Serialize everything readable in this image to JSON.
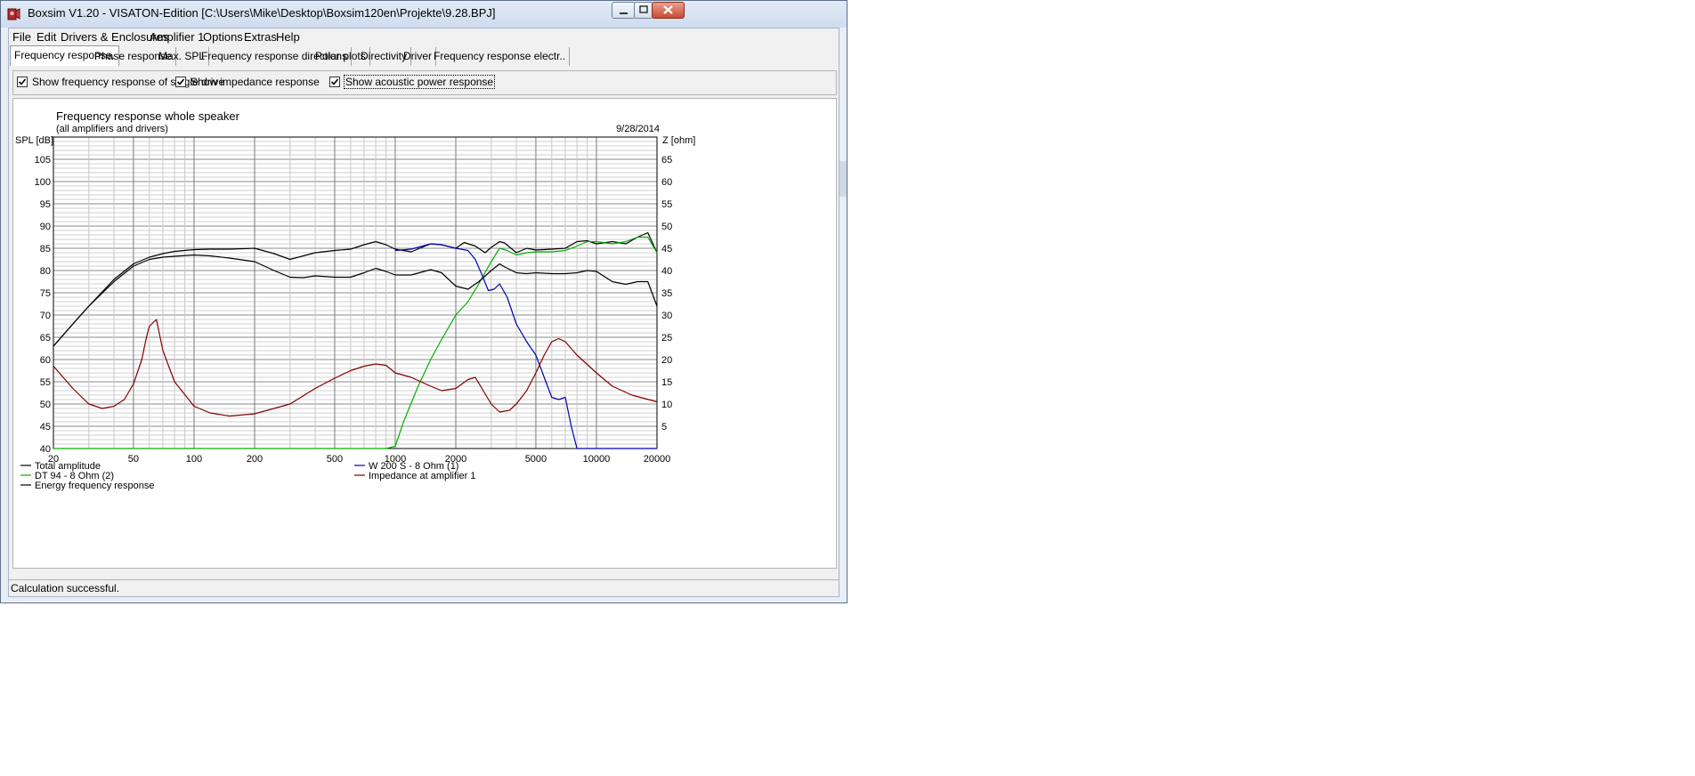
{
  "window": {
    "title": "Boxsim V1.20 - VISATON-Edition [C:\\Users\\Mike\\Desktop\\Boxsim120en\\Projekte\\9.28.BPJ]"
  },
  "menu": [
    "File",
    "Edit",
    "Drivers & Enclosures",
    "Amplifier 1",
    "Options",
    "Extras",
    "Help"
  ],
  "tabs": [
    "Frequency response.",
    "Phase response",
    "Max. SPL",
    "Frequency response directions",
    "Polar plots",
    "Directivity",
    "Driver",
    "Frequency response electr.."
  ],
  "active_tab": "Frequency response.",
  "options": {
    "single_drive": {
      "label": "Show frequency response of single drive",
      "checked": true
    },
    "impedance": {
      "label": "Show impedance response",
      "checked": true
    },
    "acoustic_power": {
      "label": "Show acoustic power response",
      "checked": true
    }
  },
  "status": "Calculation successful.",
  "colors": {
    "total": "#000000",
    "dt94": "#00b000",
    "energy": "#000000",
    "w200": "#0000b0",
    "impedance": "#800000"
  },
  "chart_data": {
    "type": "line",
    "title": "Frequency response whole speaker",
    "subtitle": "(all amplifiers and drivers)",
    "date": "9/28/2014",
    "ylabel": "SPL [dB]",
    "y2label": "Z [ohm]",
    "x_scale": "log",
    "xlim": [
      20,
      20000
    ],
    "ylim": [
      40,
      110
    ],
    "y2lim": [
      0,
      70
    ],
    "x_ticks": [
      20,
      50,
      100,
      200,
      500,
      1000,
      2000,
      5000,
      10000,
      20000
    ],
    "y_ticks": [
      40,
      45,
      50,
      55,
      60,
      65,
      70,
      75,
      80,
      85,
      90,
      95,
      100,
      105
    ],
    "y2_ticks": [
      5,
      10,
      15,
      20,
      25,
      30,
      35,
      40,
      45,
      50,
      55,
      60,
      65
    ],
    "grid": true,
    "legend_position": "bottom",
    "series": [
      {
        "name": "Total amplitude",
        "color_key": "total",
        "axis": "left",
        "x": [
          20,
          25,
          30,
          40,
          50,
          60,
          70,
          80,
          100,
          120,
          150,
          200,
          250,
          300,
          400,
          500,
          600,
          700,
          800,
          900,
          1000,
          1200,
          1500,
          1700,
          2000,
          2200,
          2500,
          2800,
          3000,
          3300,
          3500,
          4000,
          4500,
          5000,
          6000,
          7000,
          8000,
          9000,
          10000,
          12000,
          14000,
          16000,
          18000,
          20000
        ],
        "y": [
          63,
          68,
          72,
          78,
          81.5,
          83,
          83.8,
          84.3,
          84.7,
          84.8,
          84.8,
          85,
          83.8,
          82.5,
          84,
          84.5,
          84.8,
          85.8,
          86.5,
          85.8,
          84.8,
          84.2,
          86,
          85.8,
          85,
          86.3,
          85.5,
          84,
          85.2,
          86.5,
          86.2,
          84,
          85,
          84.6,
          84.8,
          85,
          86.5,
          86.7,
          86,
          86.5,
          86,
          87.5,
          88.5,
          84
        ]
      },
      {
        "name": "DT 94 - 8 Ohm (2)",
        "color_key": "dt94",
        "axis": "left",
        "x": [
          20,
          500,
          900,
          1000,
          1100,
          1300,
          1500,
          1700,
          2000,
          2300,
          2600,
          3000,
          3300,
          3600,
          4000,
          4500,
          5000,
          6000,
          7000,
          8000,
          9000,
          10000,
          12000,
          14000,
          16000,
          18000,
          20000
        ],
        "y": [
          40,
          40,
          40,
          40.5,
          46,
          54,
          60,
          64.5,
          70,
          73,
          77,
          82,
          85,
          84.5,
          83.5,
          84,
          84.2,
          84.2,
          84.5,
          85.5,
          86.5,
          86.5,
          86,
          86.5,
          87.5,
          87.5,
          84
        ]
      },
      {
        "name": "Energy frequency response",
        "color_key": "energy",
        "axis": "left",
        "x": [
          20,
          25,
          30,
          40,
          50,
          60,
          70,
          80,
          100,
          120,
          150,
          200,
          250,
          300,
          350,
          400,
          500,
          600,
          700,
          800,
          900,
          1000,
          1200,
          1500,
          1700,
          2000,
          2300,
          2600,
          3000,
          3300,
          3500,
          4000,
          4500,
          5000,
          6000,
          7000,
          8000,
          9000,
          10000,
          12000,
          14000,
          16000,
          18000,
          20000
        ],
        "y": [
          63,
          68,
          72,
          77.5,
          81,
          82.5,
          83,
          83.2,
          83.5,
          83.3,
          82.8,
          82,
          80,
          78.5,
          78.4,
          78.8,
          78.5,
          78.5,
          79.5,
          80.5,
          79.8,
          79,
          79,
          80.2,
          79.5,
          76.5,
          75.8,
          77.5,
          80,
          81.5,
          80.8,
          79.5,
          79.3,
          79.5,
          79.3,
          79.3,
          79.5,
          80,
          79.8,
          77.5,
          76.9,
          77.5,
          77.5,
          72
        ]
      },
      {
        "name": "W 200 S - 8 Ohm (1)",
        "color_key": "w200",
        "axis": "left",
        "x": [
          1000,
          1200,
          1500,
          1700,
          2000,
          2300,
          2500,
          2700,
          2900,
          3100,
          3300,
          3600,
          4000,
          4500,
          5000,
          5500,
          6000,
          6500,
          7000,
          7500,
          8000,
          8500,
          20000
        ],
        "y": [
          84.5,
          84.8,
          86,
          85.8,
          85,
          84.5,
          82.5,
          79,
          75.5,
          75.8,
          77,
          74,
          68,
          64,
          61,
          56,
          51.5,
          51,
          51.5,
          45,
          40,
          40,
          40
        ]
      },
      {
        "name": "Impedance at amplifier 1",
        "color_key": "impedance",
        "axis": "right",
        "x": [
          20,
          25,
          30,
          35,
          40,
          45,
          50,
          55,
          58,
          60,
          65,
          70,
          80,
          100,
          120,
          150,
          200,
          300,
          400,
          500,
          600,
          700,
          800,
          900,
          1000,
          1200,
          1500,
          1700,
          2000,
          2300,
          2500,
          3000,
          3300,
          3700,
          4000,
          4500,
          5000,
          5500,
          6000,
          6500,
          7000,
          8000,
          10000,
          12000,
          15000,
          20000
        ],
        "y": [
          18.5,
          13.5,
          10,
          9,
          9.5,
          11,
          14.5,
          20,
          25,
          27.5,
          29,
          22,
          15,
          9.5,
          8,
          7.3,
          7.8,
          10,
          13.5,
          15.8,
          17.5,
          18.5,
          19,
          18.7,
          17,
          16,
          14,
          13,
          13.5,
          15.5,
          16,
          10,
          8.2,
          8.6,
          10,
          13,
          17,
          21,
          24,
          24.7,
          24,
          21,
          17,
          14,
          12,
          10.5
        ]
      }
    ]
  }
}
